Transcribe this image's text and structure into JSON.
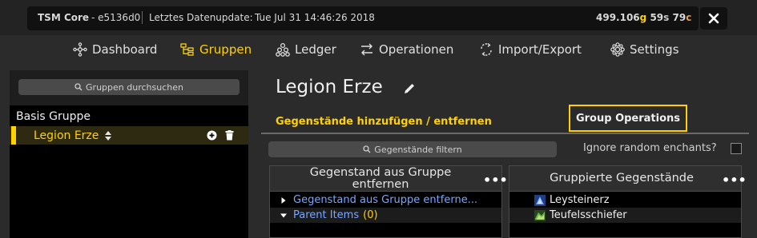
{
  "titlebar": {
    "app": "TSM Core",
    "version": "- e5136d0",
    "update_label": "Letztes Datenupdate:",
    "update_time": "Tue Jul 31 14:46:26 2018",
    "gold_value": "499.106",
    "gold_unit": "g",
    "silver_value": "59",
    "silver_unit": "s",
    "copper_value": "79",
    "copper_unit": "c"
  },
  "nav": {
    "items": [
      {
        "label": "Dashboard",
        "icon": "dashboard-icon"
      },
      {
        "label": "Gruppen",
        "icon": "groups-icon"
      },
      {
        "label": "Ledger",
        "icon": "ledger-icon"
      },
      {
        "label": "Operationen",
        "icon": "operations-icon"
      },
      {
        "label": "Import/Export",
        "icon": "import-export-icon"
      },
      {
        "label": "Settings",
        "icon": "settings-icon"
      }
    ],
    "active": "Gruppen"
  },
  "left": {
    "search_placeholder": "Gruppen durchsuchen",
    "tree": [
      {
        "label": "Basis Gruppe"
      },
      {
        "label": "Legion Erze"
      }
    ]
  },
  "main": {
    "title": "Legion Erze",
    "tabs": [
      {
        "label": "Gegenstände hinzufügen / entfernen"
      },
      {
        "label": "Group Operations"
      }
    ],
    "filter_placeholder": "Gegenstände filtern",
    "ignore_label": "Ignore random enchants?",
    "left_list": {
      "title": "Gegenstand aus Gruppe entfernen",
      "rows": [
        {
          "label": "Gegenstand aus Gruppe entferne..."
        },
        {
          "label": "Parent Items",
          "count": "(0)"
        }
      ]
    },
    "right_list": {
      "title": "Gruppierte Gegenstände",
      "rows": [
        {
          "label": "Leysteinerz"
        },
        {
          "label": "Teufelsschiefer"
        }
      ]
    }
  },
  "colors": {
    "accent": "#ffd100",
    "link": "#79a7ff",
    "background": "#2b2b2b"
  }
}
